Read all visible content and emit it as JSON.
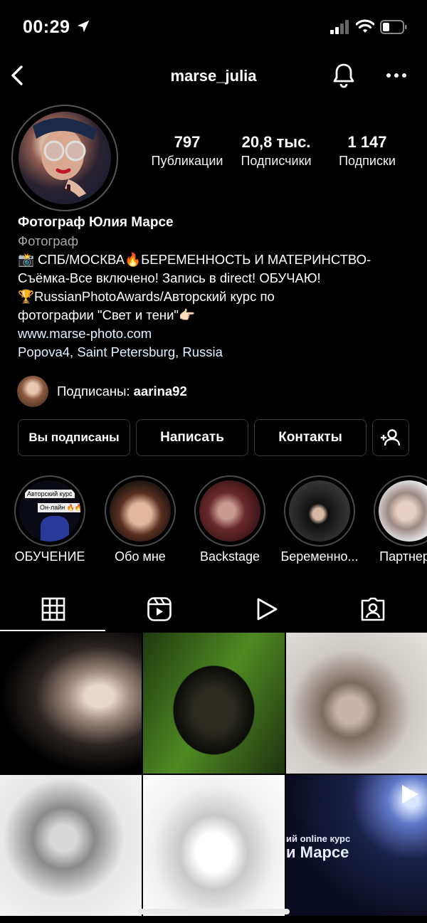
{
  "status_bar": {
    "time": "00:29",
    "battery_level": 0.3
  },
  "header": {
    "username": "marse_julia"
  },
  "stats": [
    {
      "value": "797",
      "label": "Публикации"
    },
    {
      "value": "20,8 тыс.",
      "label": "Подписчики"
    },
    {
      "value": "1 147",
      "label": "Подписки"
    }
  ],
  "bio": {
    "name": "Фотограф Юлия Марсе",
    "category": "Фотограф",
    "line1": "📸 СПБ/МОСКВА🔥БЕРЕМЕННОСТЬ И МАТЕРИНСТВО-",
    "line2": "Съёмка-Все включено! Запись в direct! ОБУЧАЮ!",
    "line3": "🏆RussianPhotoAwards/Авторский курс по",
    "line4": "фотографии \"Свет и тени\"👉🏻",
    "website": "www.marse-photo.com",
    "address": "Popova4, Saint Petersburg, Russia"
  },
  "followed_by": {
    "prefix": "Подписаны: ",
    "user": "aarina92"
  },
  "buttons": {
    "following": "Вы подписаны",
    "message": "Написать",
    "contacts": "Контакты"
  },
  "highlights": [
    {
      "label": "ОБУЧЕНИЕ",
      "overlay1": "Авторский курс",
      "overlay2": "Он-лайн 🔥🔥🔥"
    },
    {
      "label": "Обо мне"
    },
    {
      "label": "Backstage"
    },
    {
      "label": "Беременно..."
    },
    {
      "label": "Партнеры"
    }
  ],
  "grid": {
    "reel_text1": "ий online курс",
    "reel_text2": "и Марсе"
  },
  "icons": {
    "location": "location-arrow-icon",
    "back": "chevron-left-icon",
    "bell": "bell-icon",
    "more": "more-dots-icon",
    "add_person": "add-person-icon",
    "tabs": [
      "grid-icon",
      "reels-icon",
      "video-play-icon",
      "tagged-icon"
    ]
  }
}
